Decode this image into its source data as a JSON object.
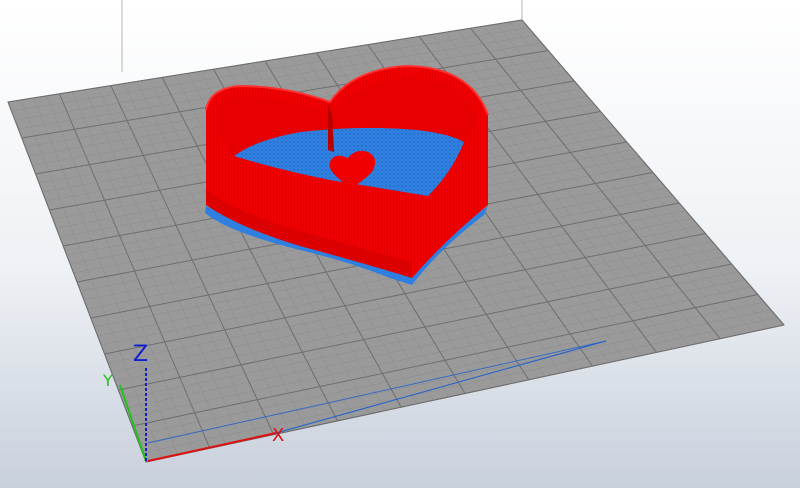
{
  "viewport": {
    "background_top": "#ffffff",
    "background_bottom": "#c8d0dc",
    "bed_color": "#9a9a9a",
    "grid_minor_color": "#8c8c8c",
    "grid_major_color": "#6e6e6e"
  },
  "model": {
    "wall_color": "#f00000",
    "wall_dark_color": "#cc0000",
    "infill_color": "#2f7fe0",
    "base_color": "#2f7fe0"
  },
  "axes": {
    "x_label": "X",
    "y_label": "Y",
    "z_label": "Z",
    "x_color": "#e01010",
    "y_color": "#22c020",
    "z_color": "#1020d0"
  }
}
